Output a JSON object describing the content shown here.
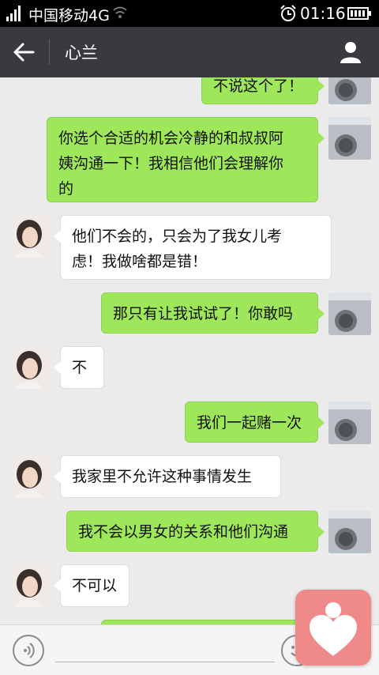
{
  "status_bar": {
    "carrier": "中国移动4G",
    "time": "01:16"
  },
  "header": {
    "contact_name": "心兰",
    "icons": [
      "back-arrow-icon",
      "person-icon"
    ]
  },
  "messages": [
    {
      "sender": "me",
      "text": "不说这个了！"
    },
    {
      "sender": "me",
      "lines": [
        "你选个合适的机会冷静的和叔叔阿",
        "姨沟通一下！我相信他们会理解你",
        "的"
      ]
    },
    {
      "sender": "her",
      "lines": [
        "他们不会的，只会为了我女儿考",
        "虑！我做啥都是错！"
      ]
    },
    {
      "sender": "me",
      "text": "那只有让我试试了！你敢吗"
    },
    {
      "sender": "her",
      "text": "不"
    },
    {
      "sender": "me",
      "text": "我们一起赌一次"
    },
    {
      "sender": "her",
      "text": "我家里不允许这种事情发生"
    },
    {
      "sender": "me",
      "text": "我不会以男女的关系和他们沟通"
    },
    {
      "sender": "her",
      "text": "不可以"
    }
  ],
  "input_bar": {
    "icons": [
      "voice-icon",
      "emoji-icon"
    ]
  },
  "colors": {
    "my_bubble": "#9fe75a",
    "their_bubble": "#ffffff",
    "title_bar": "#393a3f",
    "chat_background": "#ebebeb",
    "floating_app": "#f08a8a"
  }
}
